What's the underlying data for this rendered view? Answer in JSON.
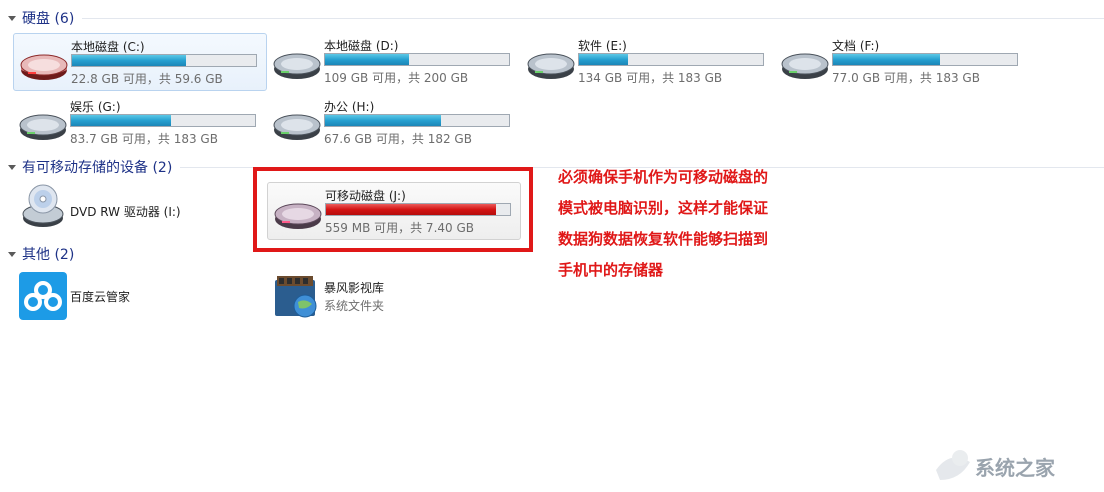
{
  "sections": {
    "hard_disks": "硬盘 (6)",
    "removable": "有可移动存储的设备 (2)",
    "other": "其他 (2)"
  },
  "drives": [
    {
      "name": "本地磁盘 (C:)",
      "space": "22.8 GB 可用，共 59.6 GB",
      "used_fraction": 0.62
    },
    {
      "name": "本地磁盘 (D:)",
      "space": "109 GB 可用，共 200 GB",
      "used_fraction": 0.455
    },
    {
      "name": "软件 (E:)",
      "space": "134 GB 可用，共 183 GB",
      "used_fraction": 0.268
    },
    {
      "name": "文档 (F:)",
      "space": "77.0 GB 可用，共 183 GB",
      "used_fraction": 0.58
    },
    {
      "name": "娱乐 (G:)",
      "space": "83.7 GB 可用，共 183 GB",
      "used_fraction": 0.543
    },
    {
      "name": "办公 (H:)",
      "space": "67.6 GB 可用，共 182 GB",
      "used_fraction": 0.628
    }
  ],
  "removable_devices": {
    "dvd": {
      "name": "DVD RW 驱动器 (I:)"
    },
    "usb": {
      "name": "可移动磁盘 (J:)",
      "space": "559 MB 可用，共 7.40 GB",
      "used_fraction": 0.926
    }
  },
  "other_items": [
    {
      "name": "百度云管家",
      "subtitle": ""
    },
    {
      "name": "暴风影视库",
      "subtitle": "系统文件夹"
    }
  ],
  "annotation": {
    "lines": [
      "必须确保手机作为可移动磁盘的",
      "模式被电脑识别，这样才能保证",
      "数据狗数据恢复软件能够扫描到",
      "手机中的存储器"
    ],
    "color": "#e01818"
  },
  "watermark": {
    "text": "系统之家"
  },
  "icons": {
    "hard_disk": "hard-disk-icon",
    "system_disk": "system-disk-icon",
    "dvd": "dvd-drive-icon",
    "usb": "removable-disk-icon",
    "baidu": "baidu-cloud-icon",
    "video_library": "video-library-icon"
  }
}
